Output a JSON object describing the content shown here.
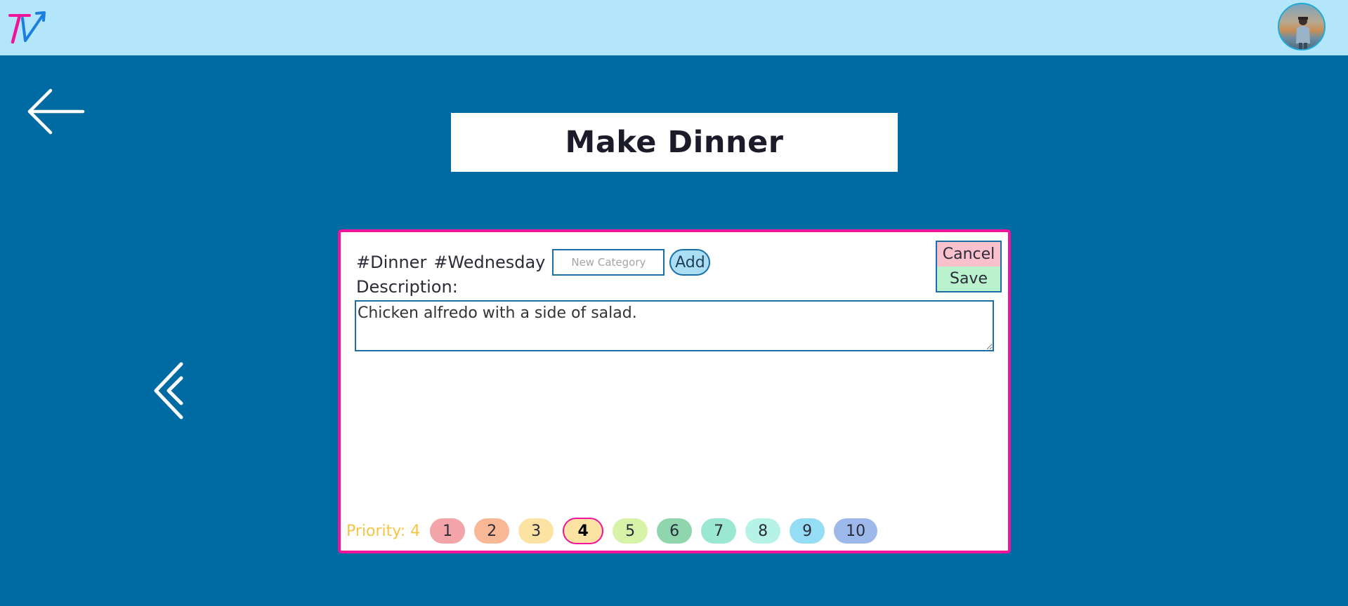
{
  "header": {
    "logo_icon": "tv-arrow-logo",
    "avatar_icon": "user-avatar"
  },
  "navigation": {
    "back_icon": "arrow-left-icon",
    "previous_icon": "double-chevron-left-icon"
  },
  "task": {
    "title": "Make Dinner",
    "tags": [
      "#Dinner",
      "#Wednesday"
    ],
    "new_category_placeholder": "New Category",
    "add_label": "Add",
    "description_label": "Description:",
    "description": "Chicken alfredo with a side of salad.",
    "cancel_label": "Cancel",
    "save_label": "Save",
    "priority_label": "Priority: 4",
    "priority_selected": 4,
    "priority_options": [
      {
        "label": "1",
        "color": "#f3a4a8"
      },
      {
        "label": "2",
        "color": "#f8b896"
      },
      {
        "label": "3",
        "color": "#fde3a3"
      },
      {
        "label": "4",
        "color": "#fde3a3"
      },
      {
        "label": "5",
        "color": "#d6f3a8"
      },
      {
        "label": "6",
        "color": "#8fd6ae"
      },
      {
        "label": "7",
        "color": "#9be8d2"
      },
      {
        "label": "8",
        "color": "#b6f2e6"
      },
      {
        "label": "9",
        "color": "#95dcf5"
      },
      {
        "label": "10",
        "color": "#9db8ea"
      }
    ]
  },
  "colors": {
    "background": "#006aa2",
    "topbar": "#b3e5fb",
    "card_border": "#f0149a",
    "priority_text": "#f4c542"
  }
}
